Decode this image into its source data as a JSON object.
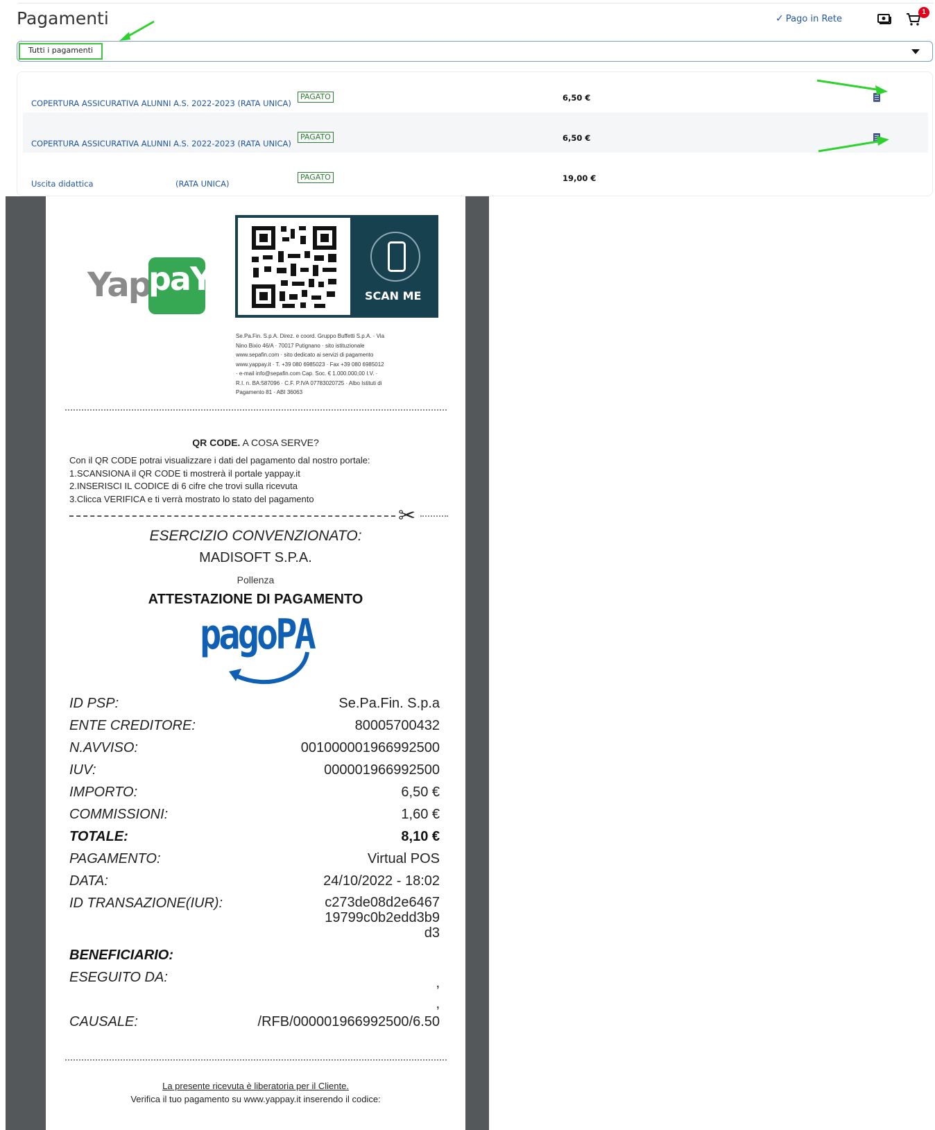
{
  "header": {
    "title": "Pagamenti",
    "pago_in_rete_label": "Pago in Rete",
    "cart_badge": "1"
  },
  "filter": {
    "selected": "Tutti i pagamenti"
  },
  "payments": [
    {
      "description": "COPERTURA ASSICURATIVA ALUNNI A.S. 2022-2023 (RATA UNICA)",
      "status": "PAGATO",
      "amount": "6,50 €"
    },
    {
      "description": "COPERTURA ASSICURATIVA ALUNNI A.S. 2022-2023 (RATA UNICA)",
      "status": "PAGATO",
      "amount": "6,50 €"
    },
    {
      "description": "Uscita didattica",
      "description_suffix": "(RATA UNICA)",
      "status": "PAGATO",
      "amount": "19,00 €"
    }
  ],
  "receipt": {
    "brand_left": "Yap",
    "brand_right": "paY",
    "scan_label": "SCAN ME",
    "company_info": [
      "Se.Pa.Fin. S.p.A. Direz. e coord. Gruppo Buffetti S.p.A. · Via",
      "Nino Bixio 46/A · 70017 Putignano · sito istituzionale",
      "www.sepafin.com · sito dedicato ai servizi di pagamento",
      "www.yappay.it · T. +39 080 6985023 · Fax +39 080 6985012",
      "· e-mail info@sepafin.com Cap. Soc. € 1.000.000,00 I.V. ·",
      "R.I. n. BA:587096 · C.F. P.IVA 07783020725 · Albo Istituti di",
      "Pagamento 81 · ABI 36063"
    ],
    "qr_title_bold": "QR CODE.",
    "qr_title_rest": " A COSA SERVE?",
    "qr_lines": [
      "Con il QR CODE potrai visualizzare i dati del pagamento dal nostro portale:",
      "1.SCANSIONA il QR CODE ti mostrerà il portale yappay.it",
      "2.INSERISCI IL CODICE di 6 cifre che trovi sulla ricevuta",
      "3.Clicca VERIFICA e ti verrà mostrato lo stato del pagamento"
    ],
    "esercizio": "ESERCIZIO CONVENZIONATO:",
    "merchant": "MADISOFT S.P.A.",
    "city": "Pollenza",
    "attestazione": "ATTESTAZIONE DI PAGAMENTO",
    "pagopa_logo": "pagoPA",
    "fields": [
      {
        "label": "ID PSP:",
        "value": "Se.Pa.Fin. S.p.a"
      },
      {
        "label": "ENTE CREDITORE:",
        "value": "80005700432"
      },
      {
        "label": "N.AVVISO:",
        "value": "001000001966992500"
      },
      {
        "label": "IUV:",
        "value": "000001966992500"
      },
      {
        "label": "IMPORTO:",
        "value": "6,50 €"
      },
      {
        "label": "COMMISSIONI:",
        "value": "1,60 €"
      },
      {
        "label": "TOTALE:",
        "value": "8,10 €"
      },
      {
        "label": "PAGAMENTO:",
        "value": "Virtual POS"
      },
      {
        "label": "DATA:",
        "value": "24/10/2022 - 18:02"
      },
      {
        "label": "ID TRANSAZIONE(IUR):",
        "value_lines": [
          "c273de08d2e6467",
          "19799c0b2edd3b9",
          "d3"
        ]
      },
      {
        "label": "BENEFICIARIO:",
        "value": ""
      },
      {
        "label": "ESEGUITO DA:",
        "value_lines": [
          ",",
          ","
        ]
      },
      {
        "label": "CAUSALE:",
        "value": "/RFB/000001966992500/6.50"
      }
    ],
    "footer_line1": "La presente ricevuta è liberatoria per il Cliente.",
    "footer_line2": "Verifica il tuo pagamento su www.yappay.it inserendo il codice:"
  },
  "colors": {
    "link_blue": "#1f56a4",
    "status_green": "#2e7d32",
    "highlight_green": "#3ec43e",
    "qr_panel": "#17414f",
    "yappay_green": "#36a853",
    "pagopa_blue": "#0f5fb5"
  }
}
